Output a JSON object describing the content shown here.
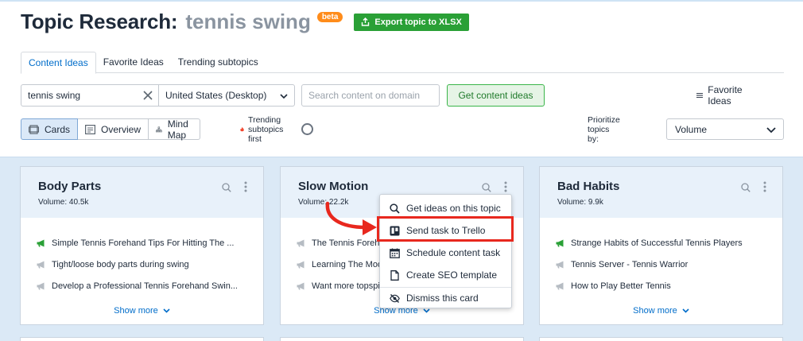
{
  "header": {
    "title": "Topic Research:",
    "topic": "tennis swing",
    "badge": "beta",
    "export_label": "Export topic to XLSX"
  },
  "tabs": [
    {
      "label": "Content Ideas",
      "active": true
    },
    {
      "label": "Favorite Ideas",
      "active": false
    },
    {
      "label": "Trending subtopics",
      "active": false
    }
  ],
  "controls": {
    "search_value": "tennis swing",
    "country": "United States (Desktop)",
    "domain_placeholder": "Search content on domain",
    "get_ideas": "Get content ideas",
    "favorite_ideas": "Favorite Ideas",
    "views": [
      "Cards",
      "Overview",
      "Mind Map"
    ],
    "active_view": "Cards",
    "trending": "Trending subtopics first",
    "trending_on": false,
    "prioritize_label": "Prioritize topics by:",
    "prioritize_value": "Volume"
  },
  "cards": [
    {
      "title": "Body Parts",
      "volume": "Volume:  40.5k",
      "items": [
        "Simple Tennis Forehand Tips For Hitting The ...",
        "Tight/loose body parts during swing",
        "Develop a Professional Tennis Forehand Swin..."
      ],
      "show_more": "Show more"
    },
    {
      "title": "Slow Motion",
      "volume": "Volume:  22.2k",
      "items": [
        "The Tennis Forehand",
        "Learning The Modern Forehand",
        "Want more topspin on your forehand"
      ],
      "show_more": "Show more"
    },
    {
      "title": "Bad Habits",
      "volume": "Volume:  9.9k",
      "items": [
        "Strange Habits of Successful Tennis Players",
        "Tennis Server - Tennis Warrior",
        "How to Play Better Tennis"
      ],
      "show_more": "Show more"
    }
  ],
  "menu": {
    "items": [
      {
        "label": "Get ideas on this topic",
        "icon": "search-icon"
      },
      {
        "label": "Send task to Trello",
        "icon": "trello-icon"
      },
      {
        "label": "Schedule content task",
        "icon": "calendar-icon"
      },
      {
        "label": "Create SEO template",
        "icon": "document-icon"
      },
      {
        "label": "Dismiss this card",
        "icon": "eye-off-icon"
      }
    ]
  },
  "colors": {
    "accent": "#006dca",
    "export_green": "#2aa036",
    "highlight_red": "#e8281e",
    "beta_orange": "#ff8c1a"
  }
}
